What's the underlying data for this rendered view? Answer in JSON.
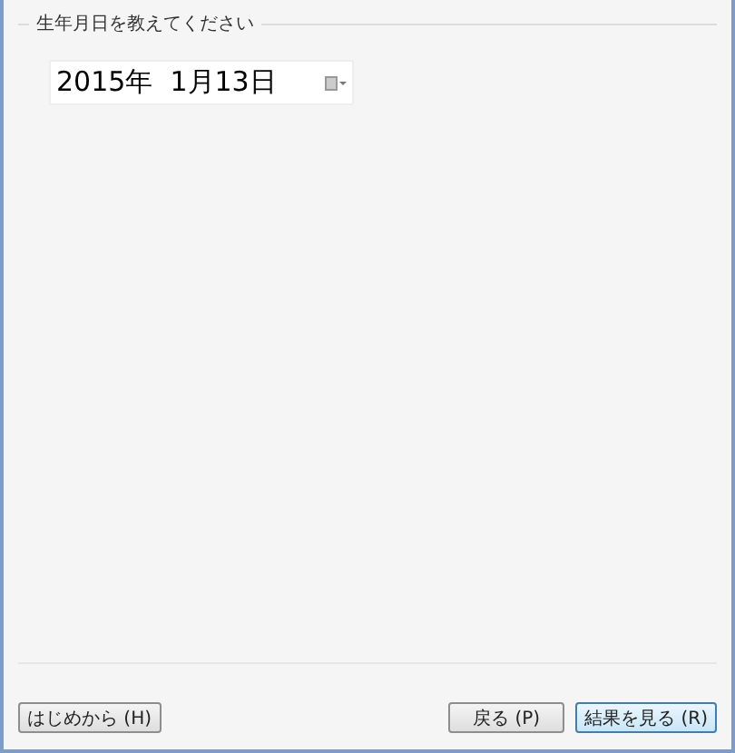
{
  "group": {
    "legend": "生年月日を教えてください"
  },
  "date_picker": {
    "value": "2015年  1月13日"
  },
  "buttons_left": [
    {
      "label": "はじめから (H)",
      "focused": false
    }
  ],
  "buttons_right": [
    {
      "label": "戻る (P)",
      "focused": false
    },
    {
      "label": "結果を見る (R)",
      "focused": true
    }
  ]
}
